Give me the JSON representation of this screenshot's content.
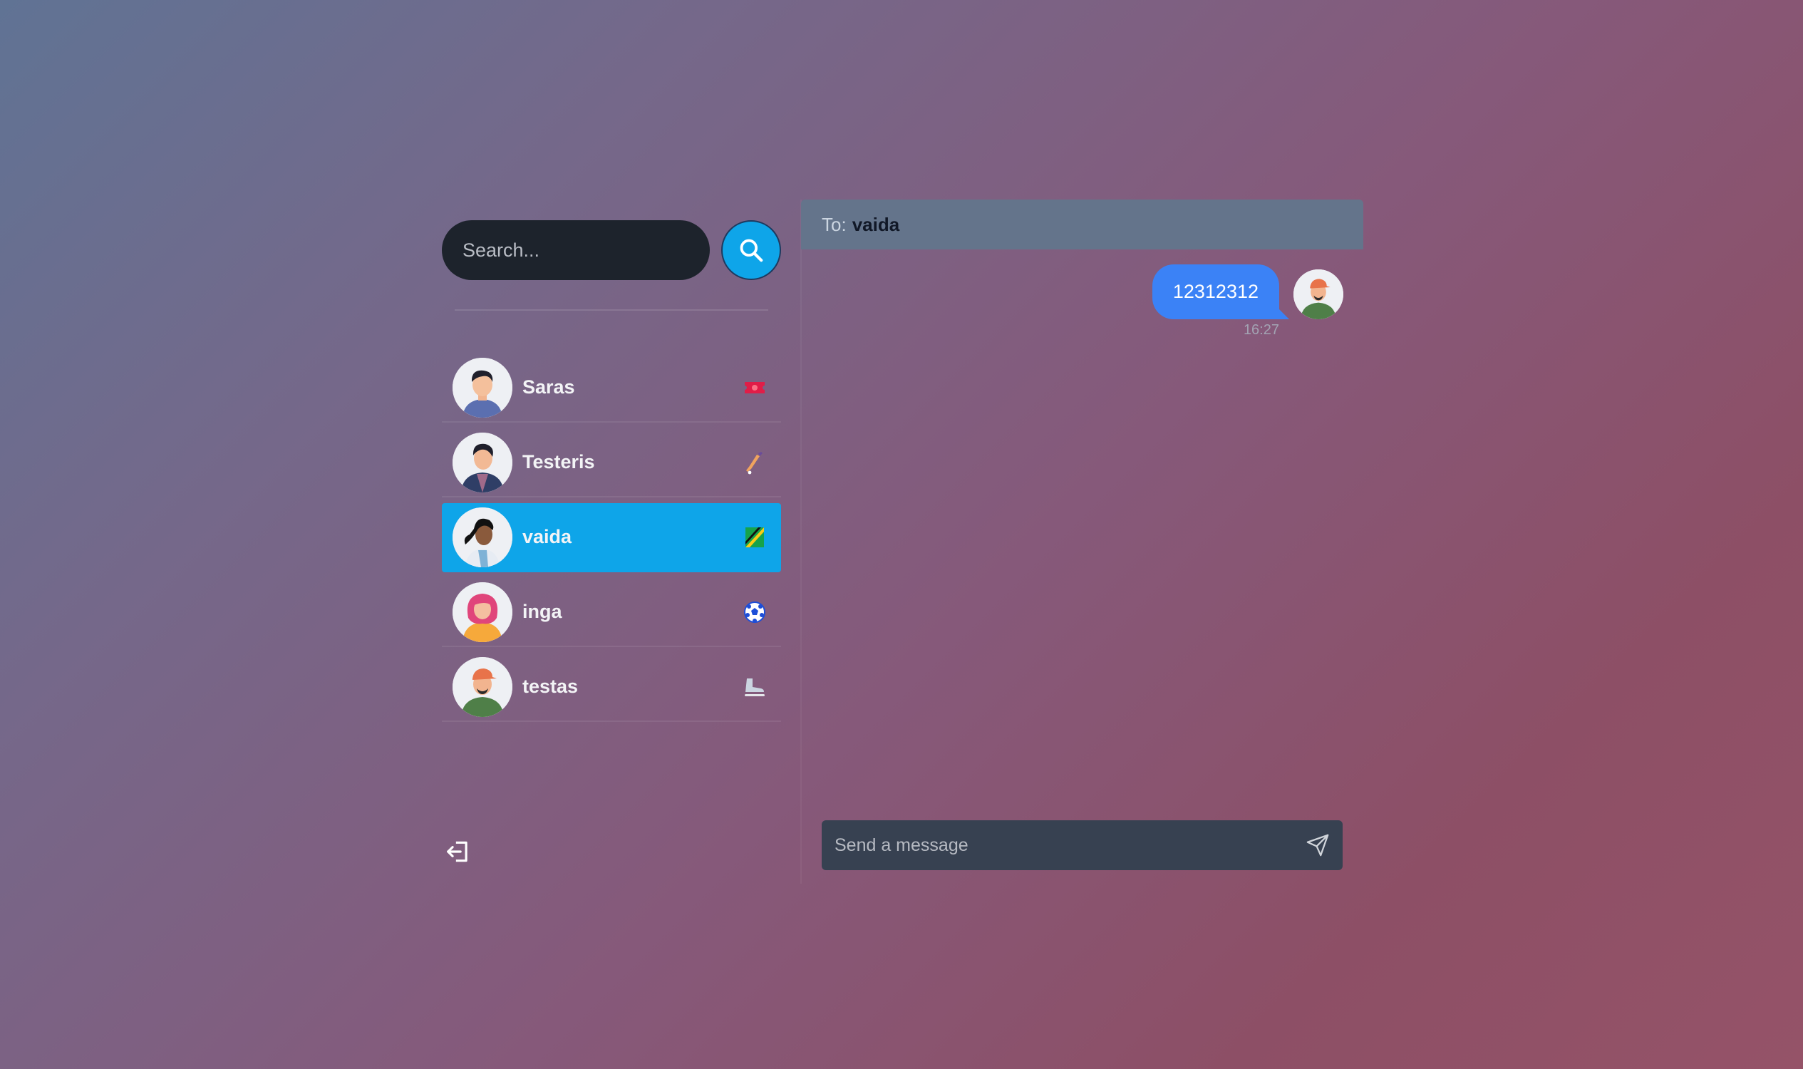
{
  "sidebar": {
    "search": {
      "placeholder": "Search..."
    },
    "contacts": [
      {
        "name": "Saras",
        "badge": "ticket-icon",
        "active": false
      },
      {
        "name": "Testeris",
        "badge": "cricket-bat-icon",
        "active": false
      },
      {
        "name": "vaida",
        "badge": "flag-icon",
        "active": true
      },
      {
        "name": "inga",
        "badge": "soccer-ball-icon",
        "active": false
      },
      {
        "name": "testas",
        "badge": "ice-skate-icon",
        "active": false
      }
    ]
  },
  "chat": {
    "to_label": "To:",
    "recipient": "vaida",
    "messages": [
      {
        "text": "12312312",
        "time": "16:27",
        "outgoing": true
      }
    ],
    "composer": {
      "placeholder": "Send a message"
    }
  },
  "colors": {
    "accent": "#0ea5e9",
    "bubble": "#3b82f6",
    "header": "#64748b",
    "composer": "#374151",
    "search_bg": "#1d232c"
  }
}
